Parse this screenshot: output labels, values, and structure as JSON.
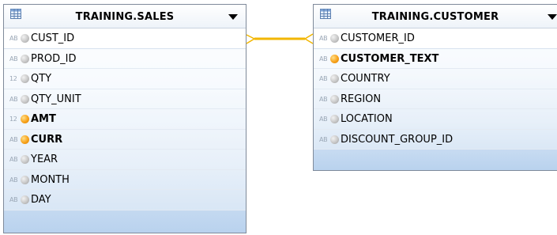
{
  "tables": [
    {
      "id": "sales",
      "title": "TRAINING.SALES",
      "columns": [
        {
          "type": "AB",
          "name": "CUST_ID",
          "key": false,
          "selected": true
        },
        {
          "type": "AB",
          "name": "PROD_ID",
          "key": false,
          "selected": false
        },
        {
          "type": "12",
          "name": "QTY",
          "key": false,
          "selected": false
        },
        {
          "type": "AB",
          "name": "QTY_UNIT",
          "key": false,
          "selected": false
        },
        {
          "type": "12",
          "name": "AMT",
          "key": true,
          "selected": false
        },
        {
          "type": "AB",
          "name": "CURR",
          "key": true,
          "selected": false
        },
        {
          "type": "AB",
          "name": "YEAR",
          "key": false,
          "selected": false
        },
        {
          "type": "AB",
          "name": "MONTH",
          "key": false,
          "selected": false
        },
        {
          "type": "AB",
          "name": "DAY",
          "key": false,
          "selected": false
        }
      ]
    },
    {
      "id": "customer",
      "title": "TRAINING.CUSTOMER",
      "columns": [
        {
          "type": "AB",
          "name": "CUSTOMER_ID",
          "key": false,
          "selected": true
        },
        {
          "type": "AB",
          "name": "CUSTOMER_TEXT",
          "key": true,
          "selected": false
        },
        {
          "type": "AB",
          "name": "COUNTRY",
          "key": false,
          "selected": false
        },
        {
          "type": "AB",
          "name": "REGION",
          "key": false,
          "selected": false
        },
        {
          "type": "AB",
          "name": "LOCATION",
          "key": false,
          "selected": false
        },
        {
          "type": "AB",
          "name": "DISCOUNT_GROUP_ID",
          "key": false,
          "selected": false
        }
      ]
    }
  ],
  "join": {
    "from": "CUST_ID",
    "to": "CUSTOMER_ID",
    "color": "#f2b600"
  },
  "colors": {
    "key_dot": "#f7a21b",
    "normal_dot": "#bdbdbd",
    "header_border": "#7f8a9a"
  }
}
